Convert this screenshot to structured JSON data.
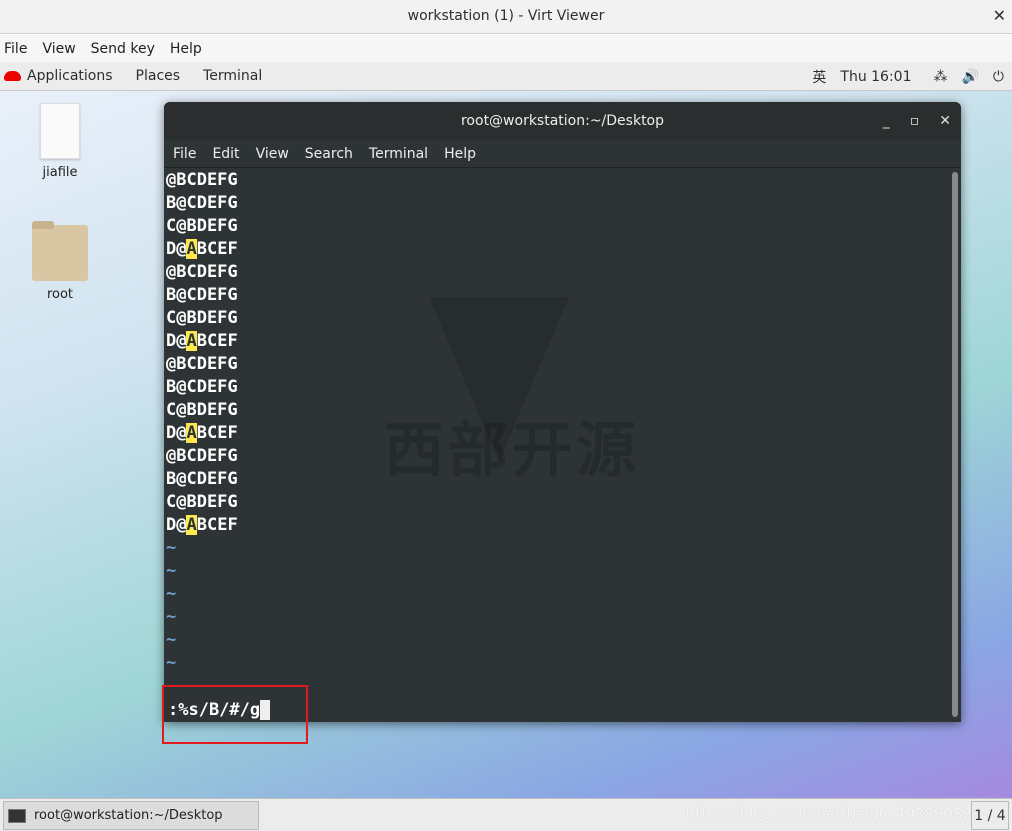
{
  "window": {
    "title": "workstation (1) - Virt Viewer",
    "close": "✕"
  },
  "menubar": [
    "File",
    "View",
    "Send key",
    "Help"
  ],
  "topbar": {
    "items": [
      "Applications",
      "Places",
      "Terminal"
    ],
    "input_method": "英",
    "clock": "Thu 16:01"
  },
  "desktop": {
    "icons": [
      {
        "label": "jiafile",
        "type": "text-file"
      },
      {
        "label": "root",
        "type": "home-folder"
      }
    ]
  },
  "terminal": {
    "title": "root@workstation:~/Desktop",
    "menu": [
      "File",
      "Edit",
      "View",
      "Search",
      "Terminal",
      "Help"
    ],
    "lines": [
      [
        "@BCDEFG",
        "",
        ""
      ],
      [
        "B@CDEFG",
        "",
        ""
      ],
      [
        "C@BDEFG",
        "",
        ""
      ],
      [
        "D@",
        "A",
        "BCEF"
      ],
      [
        "@BCDEFG",
        "",
        ""
      ],
      [
        "B@CDEFG",
        "",
        ""
      ],
      [
        "C@BDEFG",
        "",
        ""
      ],
      [
        "D@",
        "A",
        "BCEF"
      ],
      [
        "@BCDEFG",
        "",
        ""
      ],
      [
        "B@CDEFG",
        "",
        ""
      ],
      [
        "C@BDEFG",
        "",
        ""
      ],
      [
        "D@",
        "A",
        "BCEF"
      ],
      [
        "@BCDEFG",
        "",
        ""
      ],
      [
        "B@CDEFG",
        "",
        ""
      ],
      [
        "C@BDEFG",
        "",
        ""
      ],
      [
        "D@",
        "A",
        "BCEF"
      ]
    ],
    "tildes": [
      "~",
      "~",
      "~",
      "~",
      "~",
      "~"
    ],
    "command": ":%s/B/#/g",
    "watermark": "西部开源"
  },
  "taskbar": {
    "task": "root@workstation:~/Desktop",
    "workspace": "1 / 4",
    "watermark": "https://blog.csdn.net/baidu_40389082"
  },
  "colors": {
    "highlight": "#fce94f",
    "annotation_box": "#e21c1c",
    "tilde": "#729fcf"
  }
}
